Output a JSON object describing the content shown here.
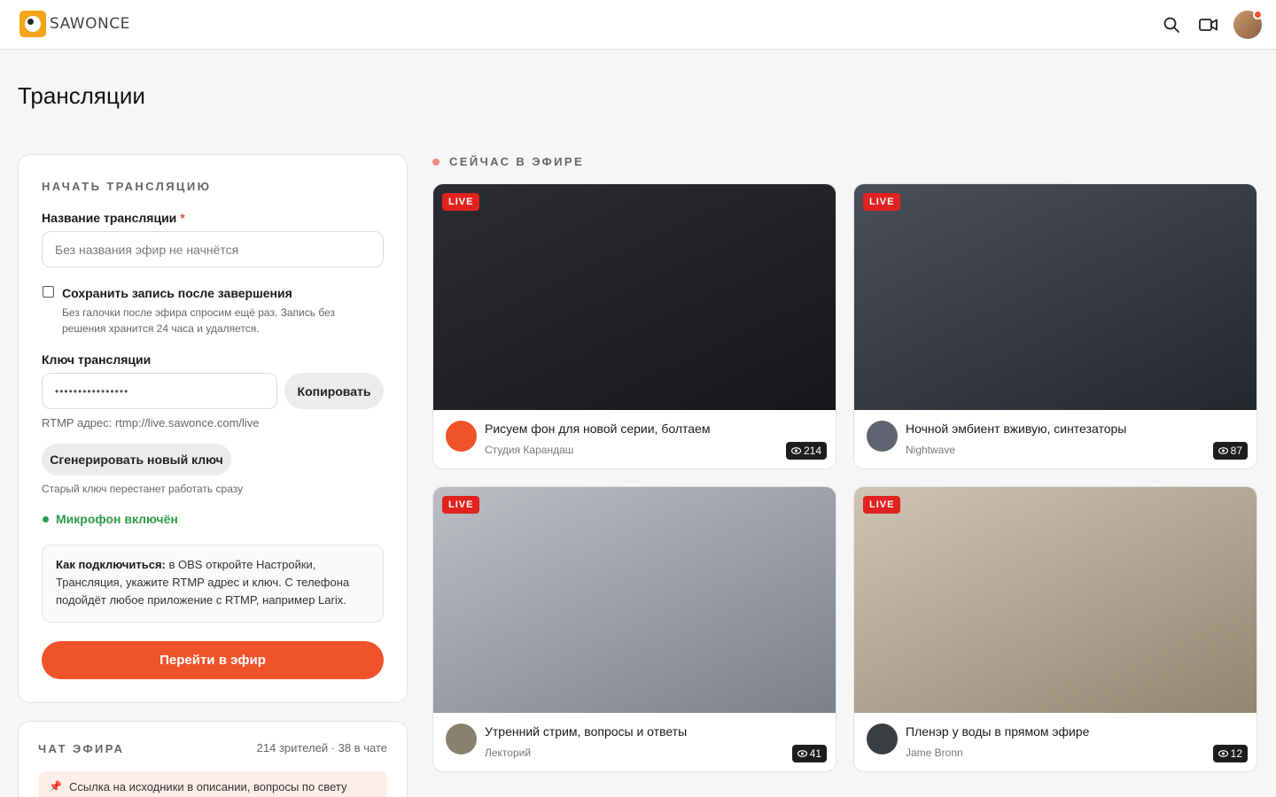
{
  "header": {
    "logo_text": "SAWONCE",
    "icons": [
      "search-icon",
      "video-camera-icon"
    ]
  },
  "page": {
    "title": "Трансляции"
  },
  "start": {
    "section_title": "НАЧАТЬ ТРАНСЛЯЦИЮ",
    "name_label": "Название трансляции",
    "required_mark": "*",
    "name_placeholder": "Без названия эфир не начнётся",
    "save_label": "Сохранить запись после завершения",
    "save_hint": "Без галочки после эфира спросим ещё раз. Запись без решения хранится 24 часа и удаляется.",
    "key_label": "Ключ трансляции",
    "key_value": "••••••••••••••••",
    "copy_label": "Копировать",
    "rtmp_text": "RTMP адрес: rtmp://live.sawonce.com/live",
    "regen_label": "Сгенерировать новый ключ",
    "regen_hint": "Старый ключ перестанет работать сразу",
    "mic_status": "Микрофон включён",
    "info_bold": "Как подключиться:",
    "info_text": " в OBS откройте Настройки, Трансляция, укажите RTMP адрес и ключ. С телефона подойдёт любое приложение с RTMP, например Larix.",
    "go_label": "Перейти в эфир"
  },
  "chat": {
    "title": "ЧАТ ЭФИРА",
    "meta": "214 зрителей · 38 в чате",
    "pinned": "Ссылка на исходники в описании, вопросы по свету"
  },
  "live": {
    "section_title": "СЕЙЧАС В ЭФИРЕ",
    "badge": "LIVE",
    "streams": [
      {
        "title": "Рисуем фон для новой серии, болтаем",
        "channel": "Студия Карандаш",
        "views": "214",
        "avatar_color": "#f0522a",
        "thumb_from": "#2b2d32",
        "thumb_to": "#16171a"
      },
      {
        "title": "Ночной эмбиент вживую, синтезаторы",
        "channel": "Nightwave",
        "views": "87",
        "avatar_color": "#5f6470",
        "thumb_from": "#4b4f58",
        "thumb_to": "#24272d"
      },
      {
        "title": "Утренний стрим, вопросы и ответы",
        "channel": "Лекторий",
        "views": "41",
        "avatar_color": "#8a8070",
        "thumb_from": "#bcbec4",
        "thumb_to": "#7b808b"
      },
      {
        "title": "Пленэр у воды в прямом эфире",
        "channel": "Jame Bronn",
        "views": "12",
        "avatar_color": "#3a3d42",
        "thumb_from": "#cfc4b4",
        "thumb_to": "#928672"
      }
    ]
  }
}
